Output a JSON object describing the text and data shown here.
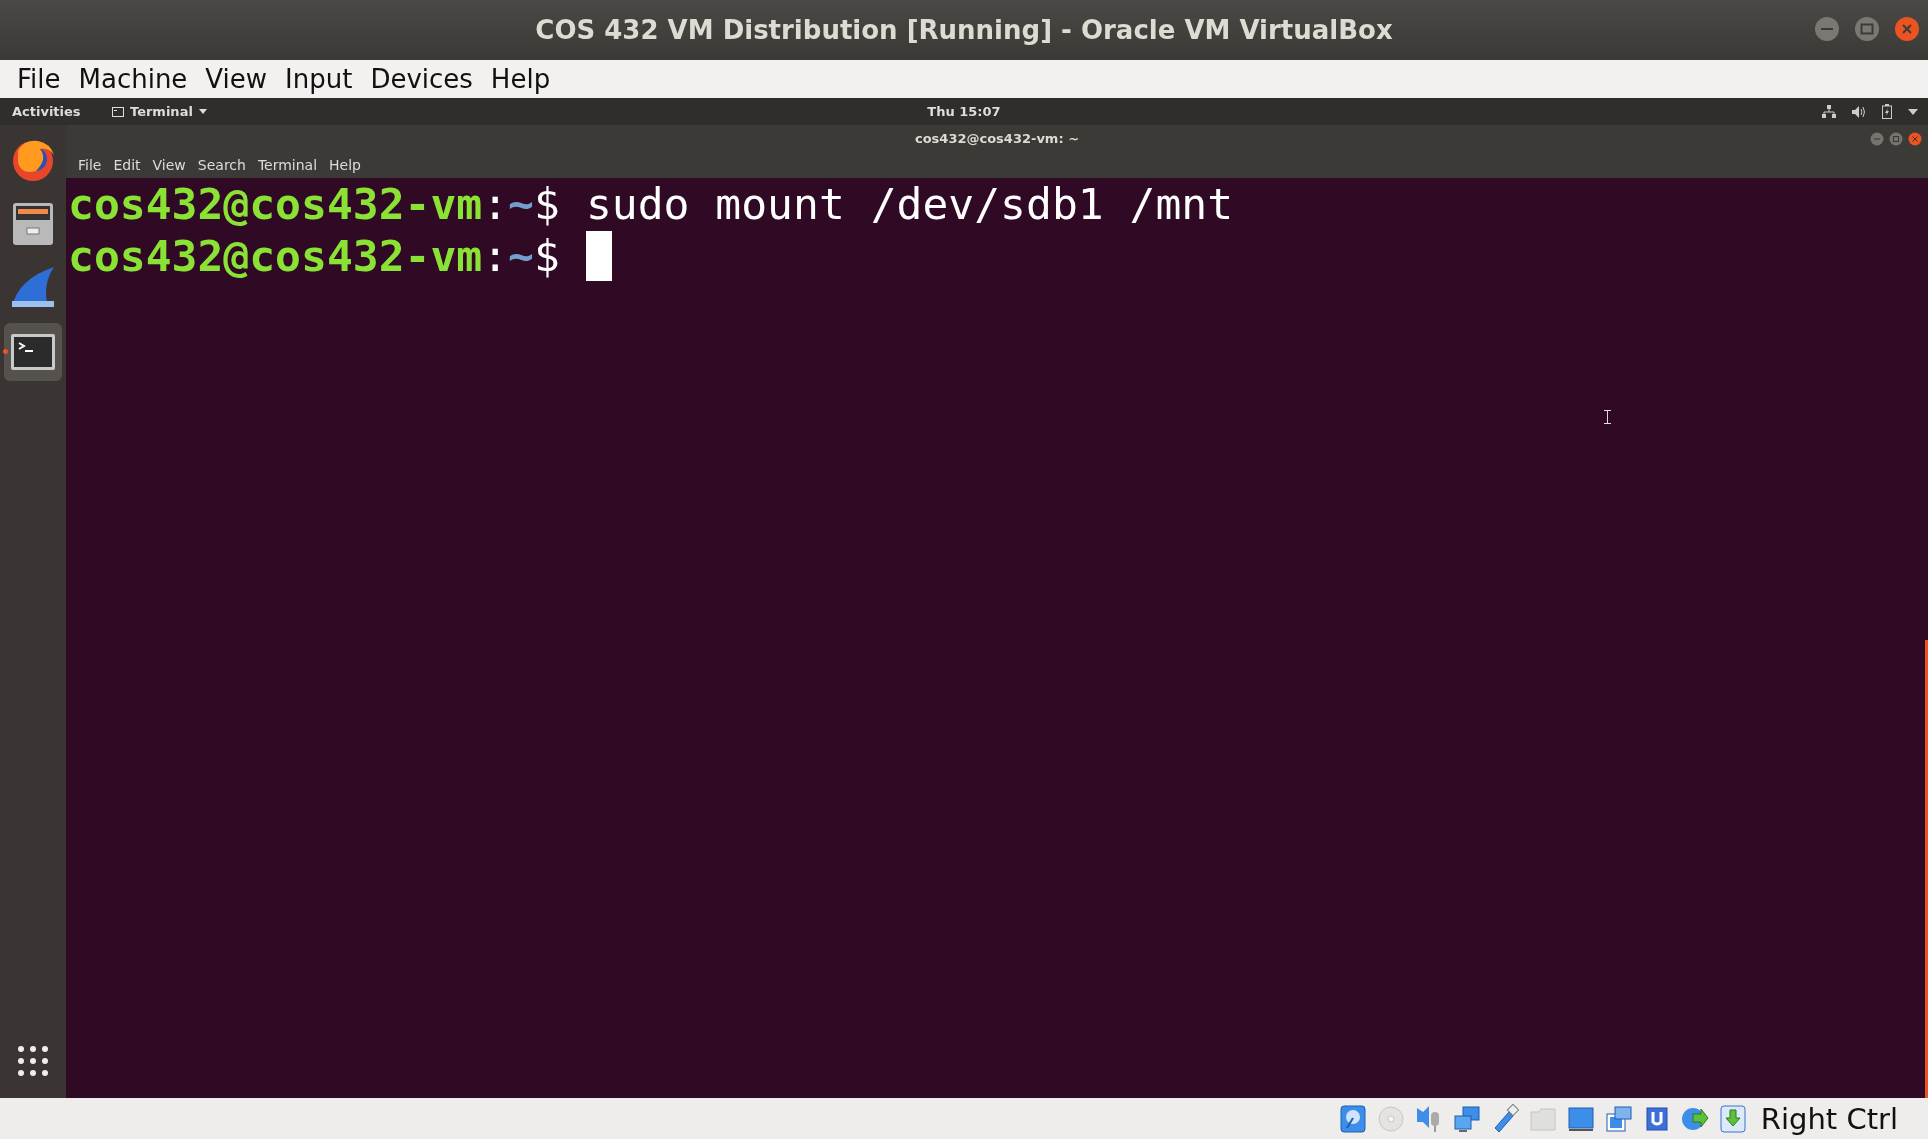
{
  "window": {
    "title": "COS 432 VM Distribution [Running] - Oracle VM VirtualBox"
  },
  "menu": [
    "File",
    "Machine",
    "View",
    "Input",
    "Devices",
    "Help"
  ],
  "top_bar": {
    "activities": "Activities",
    "app_menu": "Terminal",
    "clock": "Thu 15:07"
  },
  "dock": [
    {
      "kind": "browser",
      "selected": false,
      "running": false
    },
    {
      "kind": "files",
      "selected": false,
      "running": false
    },
    {
      "kind": "shark",
      "selected": false,
      "running": false
    },
    {
      "kind": "terminal",
      "selected": true,
      "running": true
    }
  ],
  "terminal": {
    "title": "cos432@cos432-vm: ~",
    "menu": [
      "File",
      "Edit",
      "View",
      "Search",
      "Terminal",
      "Help"
    ],
    "lines": [
      {
        "user": "cos432@cos432-vm",
        "sep": ":",
        "path": "~",
        "symbol": "$",
        "command": "sudo mount /dev/sdb1 /mnt",
        "cursor": false
      },
      {
        "user": "cos432@cos432-vm",
        "sep": ":",
        "path": "~",
        "symbol": "$",
        "cursor": true
      }
    ]
  },
  "status_bar": {
    "icons": [
      {
        "kind": "disk",
        "disabled": false
      },
      {
        "kind": "optical",
        "disabled": true
      },
      {
        "kind": "audio",
        "disabled": false
      },
      {
        "kind": "network",
        "disabled": false
      },
      {
        "kind": "usb",
        "disabled": false
      },
      {
        "kind": "folder",
        "disabled": true
      },
      {
        "kind": "display",
        "disabled": false
      },
      {
        "kind": "capture",
        "disabled": false
      },
      {
        "kind": "cpu",
        "disabled": false
      },
      {
        "kind": "mouse",
        "disabled": false
      },
      {
        "kind": "keyboard",
        "disabled": false
      }
    ],
    "host_key": "Right Ctrl"
  }
}
